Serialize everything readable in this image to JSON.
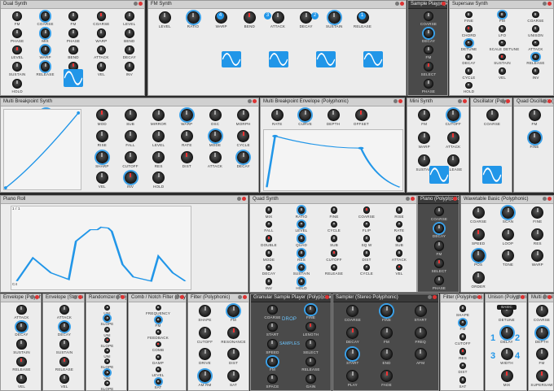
{
  "modules": {
    "dual_synth": {
      "title": "Dual Synth",
      "labels": [
        "FM",
        "COARSE",
        "FM",
        "COARSE",
        "LEVEL",
        "PHASE",
        "MIX",
        "PHASE",
        "WARP",
        "BEND",
        "LEVEL",
        "WARP",
        "BEND",
        "ATTACK",
        "DECAY",
        "SUSTAIN",
        "RELEASE",
        "CYCLE",
        "VEL",
        "INV",
        "HOLD"
      ]
    },
    "fm_synth": {
      "title": "FM Synth",
      "algo": "ALGO",
      "ops": [
        "4",
        "3",
        "2",
        "1"
      ],
      "labels": [
        "LEVEL",
        "RATIO",
        "WARP",
        "BEND",
        "ATTACK",
        "DECAY",
        "SUSTAIN",
        "RELEASE"
      ]
    },
    "sample_player": {
      "title": "Sample Player (Pol",
      "labels": [
        "COARSE",
        "DECAY",
        "FM",
        "SELECT",
        "PHASE"
      ]
    },
    "supersaw": {
      "title": "Supersaw Synth",
      "labels": [
        "FINE",
        "FM",
        "COARSE",
        "CHORD",
        "LFO",
        "UNISON",
        "DETUNE",
        "SCALE DETUNE",
        "ATTACK",
        "DECAY",
        "SUSTAIN",
        "RELEASE",
        "CYCLE",
        "VEL",
        "INV",
        "HOLD"
      ]
    },
    "multi_breakpoint": {
      "title": "Multi Breakpoint Synth",
      "labels": [
        "MIX",
        "COARSE",
        "CURVE",
        "MOD",
        "SUB",
        "MIRROR",
        "WARP",
        "OSC",
        "MORPH",
        "WARP",
        "SHAPE",
        "LP 4",
        "RISE",
        "FALL",
        "LEVEL",
        "RATE",
        "MODE",
        "CYCLE",
        "SHUFFLE",
        "FLIP",
        "SUB",
        "SHARP",
        "CUTOFF",
        "RES",
        "DIST",
        "ATTACK",
        "DECAY",
        "SUSTAIN",
        "RELEASE",
        "CYCLE",
        "VEL",
        "INV",
        "HOLD"
      ],
      "pages": [
        "1",
        "2"
      ]
    },
    "mbp_envelope": {
      "title": "Multi Breakpoint Envelope (Polyphonic)",
      "labels": [
        "RATE",
        "CURVE",
        "DEPTH",
        "OFFSET"
      ],
      "grid": [
        "ENV",
        "1",
        "2",
        "3",
        "4",
        "5",
        "6",
        "7",
        "8"
      ]
    },
    "mini_synth": {
      "title": "Mini Synth",
      "labels": [
        "FM",
        "CUTOFF",
        "WARP",
        "ATTACK",
        "SUSTAIN",
        "RELEASE"
      ]
    },
    "oscillator": {
      "title": "Oscillator (Polyp",
      "labels": [
        "COARSE"
      ]
    },
    "quad_osc": {
      "title": "Quad Oscillator (Po",
      "labels": [
        "FM",
        "FINE"
      ]
    },
    "piano_roll": {
      "title": "Piano Roll",
      "step": "1 / 1",
      "side_labels": [
        "OFF",
        "RATE",
        "PATTERN",
        "PITCH",
        "TIME",
        "EXPAND",
        "STRETCH",
        "LENGTH",
        "SWING"
      ],
      "note": "C4"
    },
    "quad_synth": {
      "title": "Quad Synth",
      "labels": [
        "MIX",
        "RATIO",
        "FINE",
        "COARSE",
        "RISE",
        "FALL",
        "LEVEL",
        "CYCLE",
        "FLIP",
        "RATE",
        "DOUBLE",
        "QUAD",
        "SUB",
        "SQ W",
        "SUB",
        "MODE",
        "RES",
        "CUTOFF",
        "DIST",
        "ATTACK",
        "DECAY",
        "SUSTAIN",
        "RELEASE",
        "CYCLE",
        "VEL",
        "INV",
        "HOLD"
      ]
    },
    "piano_poly": {
      "title": "Piano (Polyphonic)",
      "labels": [
        "COARSE",
        "DECAY",
        "FM",
        "SELECT",
        "PHASE"
      ]
    },
    "wavetable": {
      "title": "Wavetable Basic (Polyphonic)",
      "labels": [
        "COARSE",
        "SCAN",
        "FINE",
        "SPEED",
        "LOOP",
        "RES",
        "POS",
        "TONE",
        "WARP",
        "ORDER"
      ]
    },
    "envelope": {
      "title": "Envelope (Polypho",
      "labels": [
        "ATTACK",
        "DECAY",
        "SUSTAIN",
        "RELEASE",
        "VEL"
      ]
    },
    "envelope_stereo": {
      "title": "Envelope (Stereo P",
      "labels": [
        "ATTACK",
        "DECAY",
        "SUSTAIN",
        "RELEASE",
        "VEL"
      ]
    },
    "randomizer": {
      "title": "Randomizer (Polyp",
      "labels": [
        "UNI",
        "SLOPE",
        "UNI",
        "SLOPE",
        "UNI",
        "SLOPE",
        "UNI",
        "SLOPE"
      ]
    },
    "comb": {
      "title": "Comb / Notch Filter (Polyph",
      "labels": [
        "FREQUENCY",
        "FM",
        "FEEDBACK",
        "COMB",
        "DAMP",
        "LEVEL",
        "SAT"
      ]
    },
    "filter1": {
      "title": "Filter (Polyphonic)",
      "labels": [
        "SHAPE",
        "FM",
        "CUTOFF",
        "RESONANCE",
        "DRIVE",
        "DIST",
        "AM RM",
        "SAT"
      ]
    },
    "granular": {
      "title": "Granular Sample Player (Polyphonic)",
      "drop": "DROP",
      "samples": "SAMPLES",
      "labels": [
        "COARSE",
        "FINE",
        "START",
        "LENGTH",
        "SPEED",
        "SELECT",
        "FM",
        "RELEASE",
        "SPACE",
        "GAIN"
      ]
    },
    "sampler": {
      "title": "Sampler (Stereo Polyphonic)",
      "labels": [
        "COARSE",
        "FINE",
        "START",
        "DECAY",
        "FM",
        "FREQ",
        "START",
        "END",
        "AFM",
        "PLAY",
        "FADE"
      ]
    },
    "filter2": {
      "title": "Filter (Polyphonic)",
      "labels": [
        "SHAPE",
        "FM",
        "CUTOFF",
        "RES",
        "DIST",
        "SAT"
      ]
    },
    "unison": {
      "title": "Unison (Polyphonic)",
      "mode": "BASIC",
      "labels": [
        "DETUNE",
        "DELAY",
        "WIDTH",
        "MIX"
      ],
      "nums": [
        "1",
        "2",
        "3",
        "4"
      ]
    },
    "multi_osc": {
      "title": "Multi Oscilla",
      "labels": [
        "COARSE",
        "DEPTH",
        "FM",
        "SUPERSAW"
      ]
    }
  },
  "colors": {
    "accent": "#2196e8",
    "panel": "#ececec",
    "dark": "#4a4a4a",
    "knob": "#1e1e1e"
  }
}
